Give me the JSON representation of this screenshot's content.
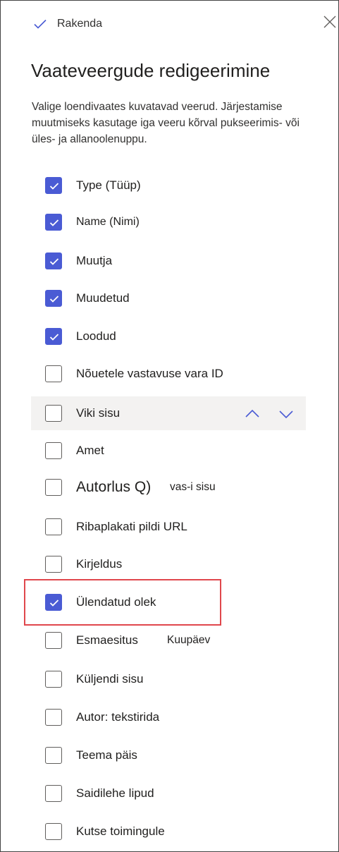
{
  "header": {
    "apply_label": "Rakenda",
    "title": "Vaateveergude redigeerimine",
    "description": "Valige loendivaates kuvatavad veerud. Järjestamise muutmiseks kasutage iga veeru kõrval pukseerimis- või üles- ja allanoolenuppu."
  },
  "icons": {
    "apply": "check-icon",
    "close": "close-icon",
    "move_up": "chevron-up-icon",
    "move_down": "chevron-down-icon"
  },
  "colors": {
    "checkbox_checked": "#4a5bd4",
    "highlight_border": "#e0474c",
    "row_hover": "#f3f2f1"
  },
  "columns": [
    {
      "label": "Type (Tüüp)",
      "checked": true
    },
    {
      "label": "Name (Nimi)",
      "checked": true
    },
    {
      "label": "Muutja",
      "checked": true
    },
    {
      "label": "Muudetud",
      "checked": true
    },
    {
      "label": "Loodud",
      "checked": true
    },
    {
      "label": "Nõuetele vastavuse vara ID",
      "checked": false
    },
    {
      "label": "Viki sisu",
      "checked": false
    },
    {
      "label": "Amet",
      "checked": false
    },
    {
      "label": "Autorlus Q)",
      "extra": "vas-i sisu",
      "checked": false
    },
    {
      "label": "Ribaplakati pildi URL",
      "checked": false
    },
    {
      "label": "Kirjeldus",
      "checked": false
    },
    {
      "label": "Ülendatud olek",
      "checked": true
    },
    {
      "label": "Esmaesitus",
      "extra": "Kuupäev",
      "checked": false
    },
    {
      "label": "Küljendi sisu",
      "checked": false
    },
    {
      "label": "Autor: tekstirida",
      "checked": false
    },
    {
      "label": "Teema päis",
      "checked": false
    },
    {
      "label": "Saidilehe lipud",
      "checked": false
    },
    {
      "label": "Kutse toimingule",
      "checked": false
    }
  ]
}
